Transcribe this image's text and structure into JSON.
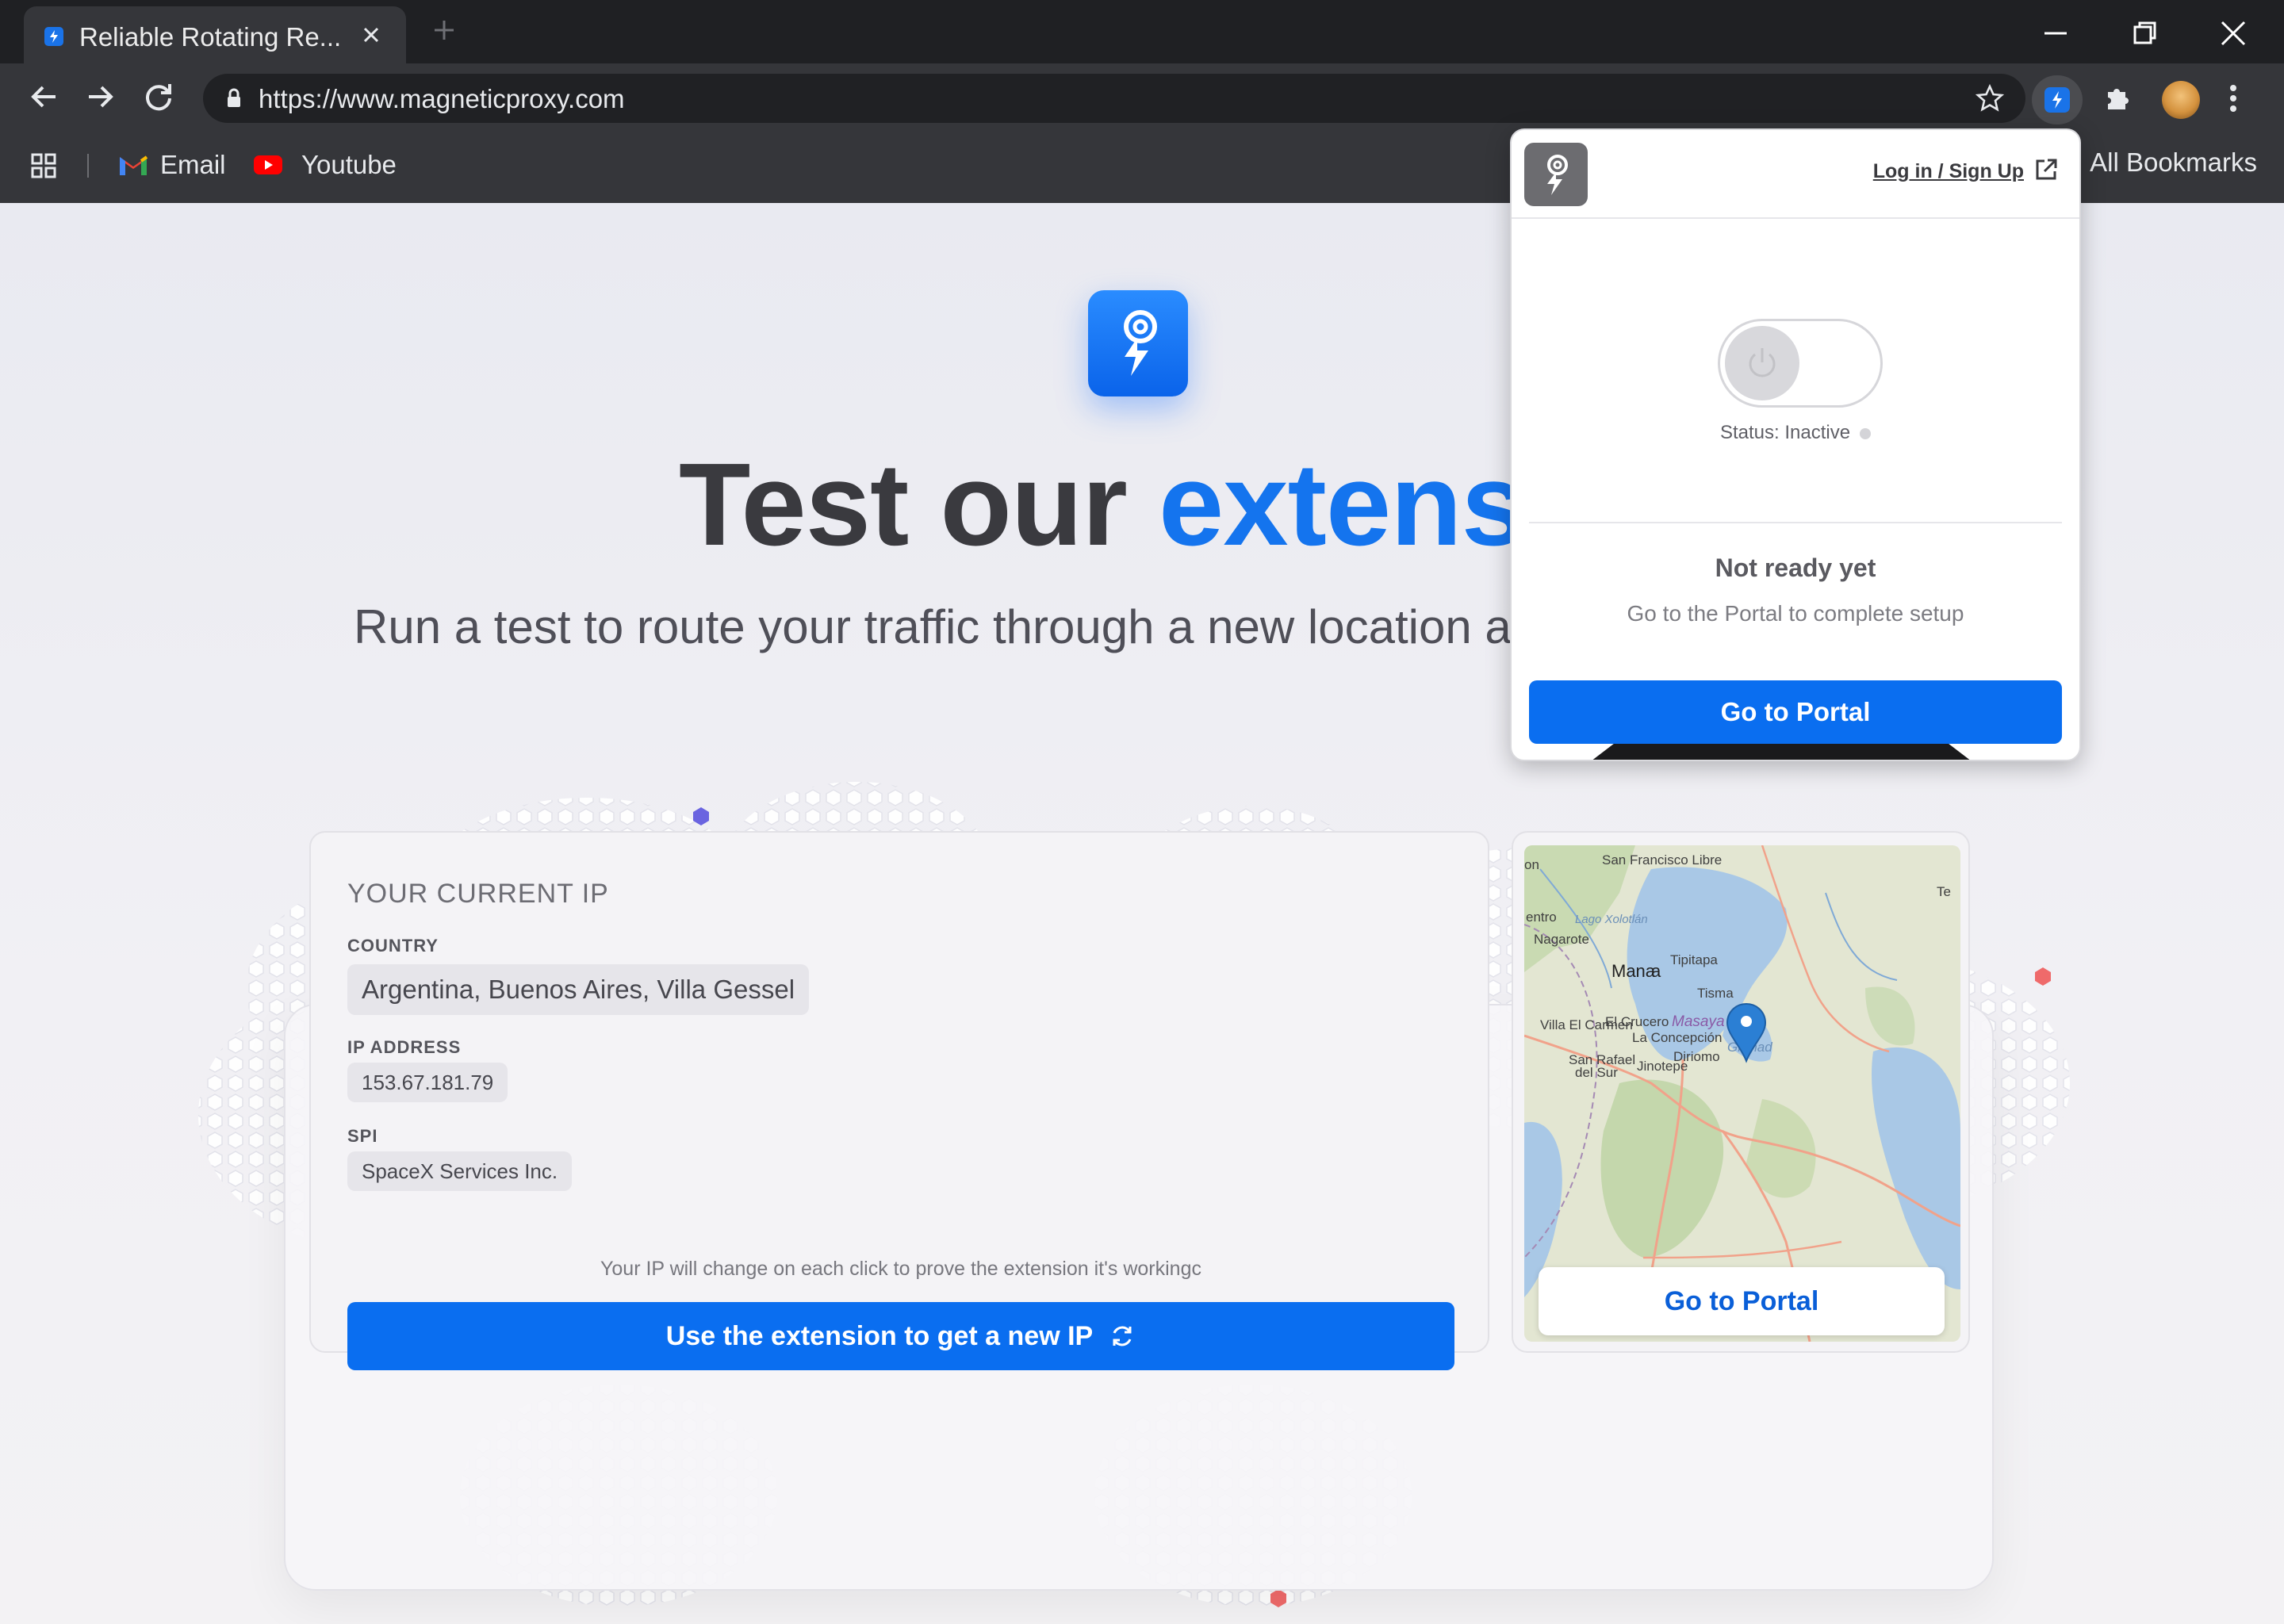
{
  "browser": {
    "tab_title": "Reliable Rotating Re...",
    "url": "https://www.magneticproxy.com",
    "bookmarks": [
      {
        "label": "Email",
        "icon": "gmail-icon"
      },
      {
        "label": "Youtube",
        "icon": "youtube-icon"
      }
    ],
    "all_bookmarks": "All Bookmarks"
  },
  "hero": {
    "title_part1": "Test our ",
    "title_part2": "extensic",
    "subtitle": "Run a test to route your traffic through a new location ar"
  },
  "ip_card": {
    "heading": "YOUR CURRENT IP",
    "country_label": "COUNTRY",
    "country_value": "Argentina, Buenos Aires, Villa Gessel",
    "ip_label": "IP ADDRESS",
    "ip_value": "153.67.181.79",
    "spi_label": "SPI",
    "spi_value": "SpaceX Services Inc.",
    "note": "Your IP will change on each click to prove the extension it's workingc",
    "button_label": "Use the extension to get a new IP"
  },
  "map_card": {
    "labels": [
      "San Francisco Libre",
      "Te",
      "entro",
      "Lago Xolotlán",
      "Nagarote",
      "Tipitapa",
      "Mana",
      "a",
      "Tisma",
      "Villa El Carmen",
      "El Crucero",
      "Masaya",
      "La Concepción",
      "Granad",
      "San Rafael",
      "del Sur",
      "Diriomo",
      "Jinotepe",
      "on"
    ],
    "button_label": "Go to Portal"
  },
  "popup": {
    "login_label": "Log in / Sign Up",
    "status_text": "Status: Inactive",
    "ready_title": "Not ready yet",
    "ready_subtitle": "Go to the Portal to complete setup",
    "portal_button": "Go to Portal"
  },
  "colors": {
    "accent": "#0a6ef0",
    "title_accent": "#1474ee",
    "chrome_dark": "#35363a"
  }
}
